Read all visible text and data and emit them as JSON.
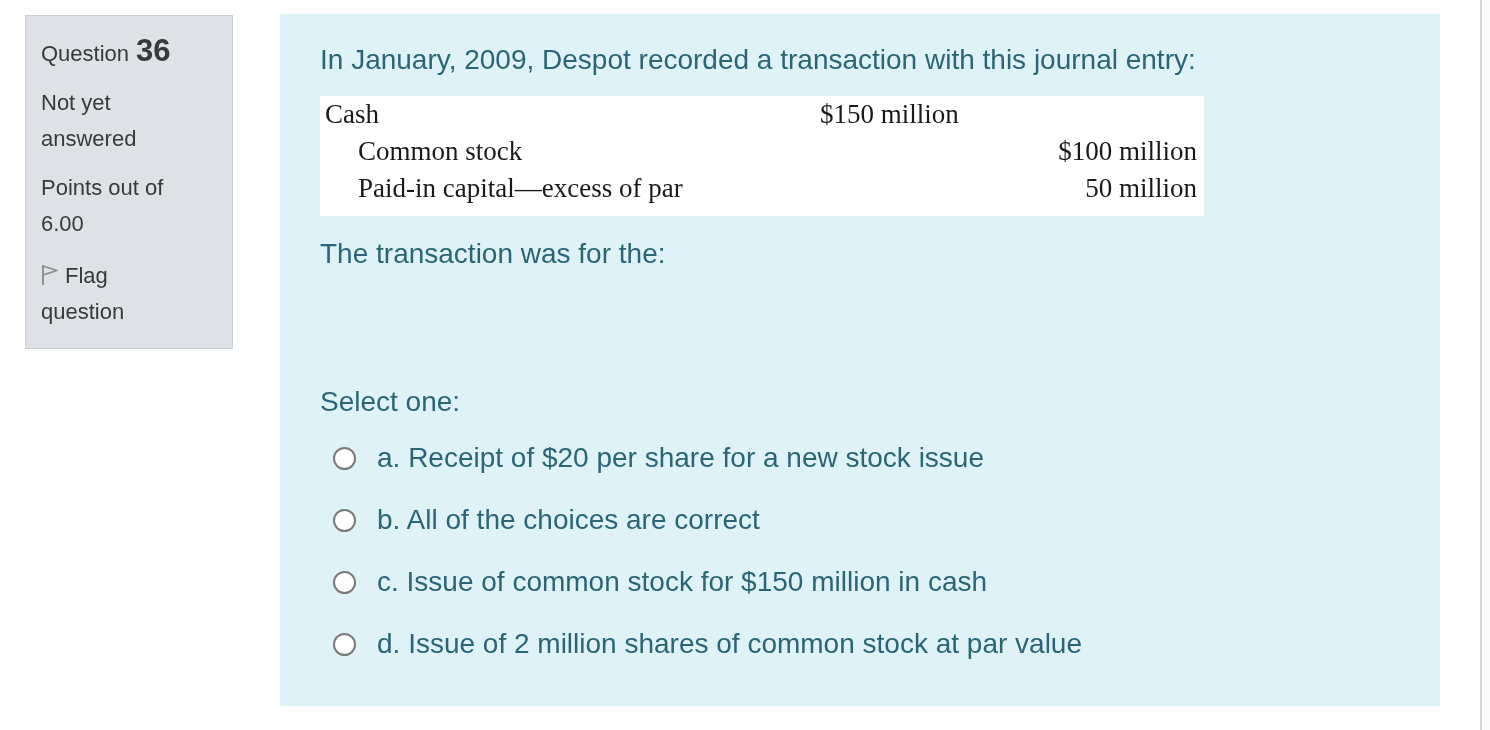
{
  "question_info": {
    "label": "Question",
    "number": "36",
    "status": "Not yet answered",
    "points": "Points out of 6.00",
    "flag_link": "Flag question"
  },
  "question": {
    "text": "In January, 2009, Despot recorded a transaction with this journal entry:",
    "journal_entry": [
      {
        "kind": "debit",
        "account": "Cash",
        "amount": "$150 million"
      },
      {
        "kind": "credit",
        "account": "Common stock",
        "amount": "$100 million"
      },
      {
        "kind": "credit",
        "account": "Paid-in capital—excess of par",
        "amount": "50 million"
      }
    ],
    "prompt": "The transaction was for the:",
    "select_label": "Select one:",
    "options": [
      {
        "label": "a. Receipt of $20 per share for a new stock issue",
        "selected": false
      },
      {
        "label": "b. All of the choices are correct",
        "selected": false
      },
      {
        "label": "c. Issue of common stock for $150 million in cash",
        "selected": false
      },
      {
        "label": "d. Issue of 2 million shares of common stock at par value",
        "selected": false
      }
    ]
  }
}
